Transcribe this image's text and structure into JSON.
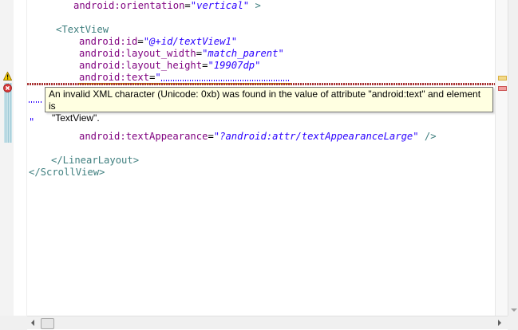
{
  "editor": {
    "lines": {
      "orientation": {
        "attr": "android:orientation",
        "eq": "=",
        "value": "\"vertical\"",
        "close": " >"
      },
      "textview_open": {
        "text": "<TextView"
      },
      "id": {
        "attr": "android:id",
        "eq": "=",
        "value": "\"@+id/textView1\""
      },
      "layout_width": {
        "attr": "android:layout_width",
        "eq": "=",
        "value": "\"match_parent\""
      },
      "layout_height": {
        "attr": "android:layout_height",
        "eq": "=",
        "value": "\"19907dp\""
      },
      "text": {
        "attr": "android:text",
        "eq": "=",
        "value": "\""
      },
      "text_close_quote": {
        "value": "\""
      },
      "text_appearance": {
        "attr": "android:textAppearance",
        "eq": "=",
        "value": "\"?android:attr/textAppearanceLarge\"",
        "close": " />"
      },
      "linearlayout_close": {
        "text": "</LinearLayout>"
      },
      "scrollview_close": {
        "text": "</ScrollView>"
      }
    }
  },
  "tooltip": {
    "line1": "An invalid XML character (Unicode: 0xb) was found in the value of attribute \"android:text\" and element is",
    "line2": "\"TextView\"."
  },
  "markers": {
    "warning_icon": "warning-icon",
    "error_icon": "error-icon"
  },
  "colors": {
    "tag": "#3f7f7f",
    "attribute": "#7f007f",
    "value": "#2a00ff",
    "tooltip_bg": "#ffffe1",
    "error": "#d02020",
    "warning": "#e8c000"
  }
}
